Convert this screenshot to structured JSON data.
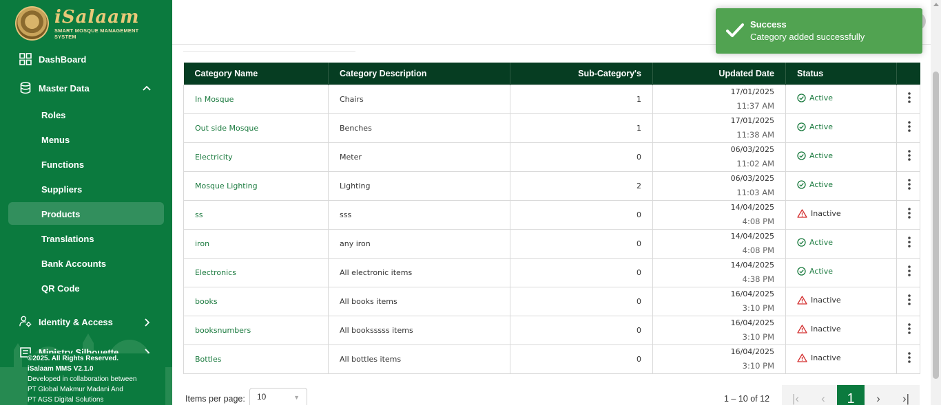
{
  "brand": {
    "name": "iSalaam",
    "tagline": "SMART MOSQUE MANAGEMENT SYSTEM"
  },
  "sidebar": {
    "dashboard": "DashBoard",
    "master_data": "Master Data",
    "sub_items": [
      "Roles",
      "Menus",
      "Functions",
      "Suppliers",
      "Products",
      "Translations",
      "Bank Accounts",
      "QR Code"
    ],
    "active_sub_item": "Products",
    "identity_access": "Identity & Access",
    "ministry": "Ministry Silhouette",
    "footer": {
      "copyright": "©2025. All Rights Reserved.",
      "version": "iSalaam MMS V2.1.0",
      "collab": "Developed in collaboration between",
      "company1": "PT Global Makmur Madani And",
      "company2": "PT AGS Digital Solutions"
    }
  },
  "table": {
    "headers": {
      "name": "Category Name",
      "description": "Category Description",
      "subcount": "Sub-Category's",
      "updated": "Updated Date",
      "status": "Status"
    },
    "rows": [
      {
        "name": "In Mosque",
        "description": "Chairs",
        "subcount": "1",
        "date": "17/01/2025",
        "time": "11:37 AM",
        "status": "Active"
      },
      {
        "name": "Out side Mosque",
        "description": "Benches",
        "subcount": "1",
        "date": "17/01/2025",
        "time": "11:38 AM",
        "status": "Active"
      },
      {
        "name": "Electricity",
        "description": "Meter",
        "subcount": "0",
        "date": "06/03/2025",
        "time": "11:02 AM",
        "status": "Active"
      },
      {
        "name": "Mosque Lighting",
        "description": "Lighting",
        "subcount": "2",
        "date": "06/03/2025",
        "time": "11:03 AM",
        "status": "Active"
      },
      {
        "name": "ss",
        "description": "sss",
        "subcount": "0",
        "date": "14/04/2025",
        "time": "4:08 PM",
        "status": "Inactive"
      },
      {
        "name": "iron",
        "description": "any iron",
        "subcount": "0",
        "date": "14/04/2025",
        "time": "4:08 PM",
        "status": "Active"
      },
      {
        "name": "Electronics",
        "description": "All electronic items",
        "subcount": "0",
        "date": "14/04/2025",
        "time": "4:38 PM",
        "status": "Active"
      },
      {
        "name": "books",
        "description": "All books items",
        "subcount": "0",
        "date": "16/04/2025",
        "time": "3:10 PM",
        "status": "Inactive"
      },
      {
        "name": "booksnumbers",
        "description": "All booksssss items",
        "subcount": "0",
        "date": "16/04/2025",
        "time": "3:10 PM",
        "status": "Inactive"
      },
      {
        "name": "Bottles",
        "description": "All bottles items",
        "subcount": "0",
        "date": "16/04/2025",
        "time": "3:10 PM",
        "status": "Inactive"
      }
    ]
  },
  "paginator": {
    "items_per_page_label": "Items per page:",
    "items_per_page_value": "10",
    "range_label": "1 – 10 of 12",
    "current_page": "1"
  },
  "toast": {
    "title": "Success",
    "message": "Category added successfully"
  },
  "colors": {
    "sidebar": "#0b7a3e",
    "header": "#063d22",
    "active_status": "#1a7a3e",
    "inactive_icon": "#d32f2f",
    "toast": "#51a351"
  }
}
